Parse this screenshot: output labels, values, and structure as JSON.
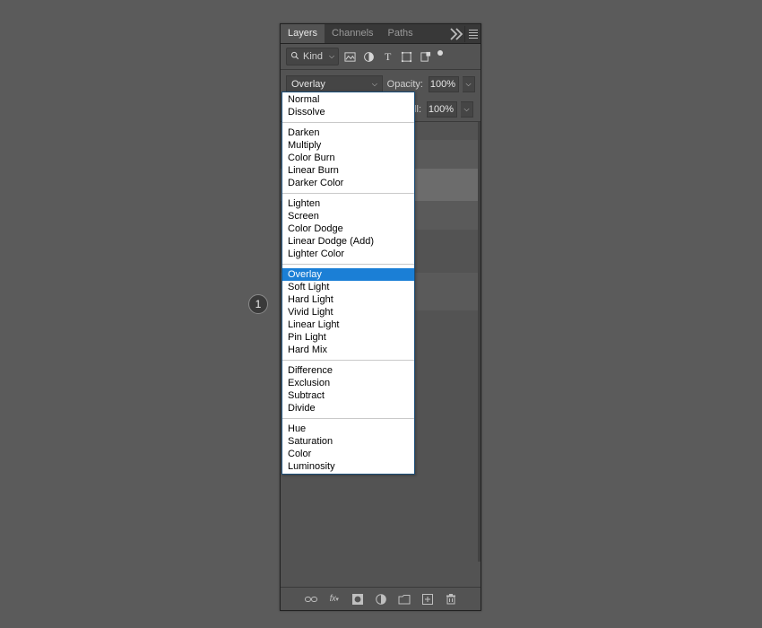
{
  "tabs": {
    "layers": "Layers",
    "channels": "Channels",
    "paths": "Paths"
  },
  "filter": {
    "kind_label": "Kind"
  },
  "blend": {
    "selected": "Overlay"
  },
  "opacity": {
    "label": "Opacity:",
    "value": "100%"
  },
  "fill": {
    "label": "Fill:",
    "value": "100%"
  },
  "callout": {
    "number": "1"
  },
  "blend_modes": [
    [
      "Normal",
      "Dissolve"
    ],
    [
      "Darken",
      "Multiply",
      "Color Burn",
      "Linear Burn",
      "Darker Color"
    ],
    [
      "Lighten",
      "Screen",
      "Color Dodge",
      "Linear Dodge (Add)",
      "Lighter Color"
    ],
    [
      "Overlay",
      "Soft Light",
      "Hard Light",
      "Vivid Light",
      "Linear Light",
      "Pin Light",
      "Hard Mix"
    ],
    [
      "Difference",
      "Exclusion",
      "Subtract",
      "Divide"
    ],
    [
      "Hue",
      "Saturation",
      "Color",
      "Luminosity"
    ]
  ],
  "blend_selected": "Overlay"
}
